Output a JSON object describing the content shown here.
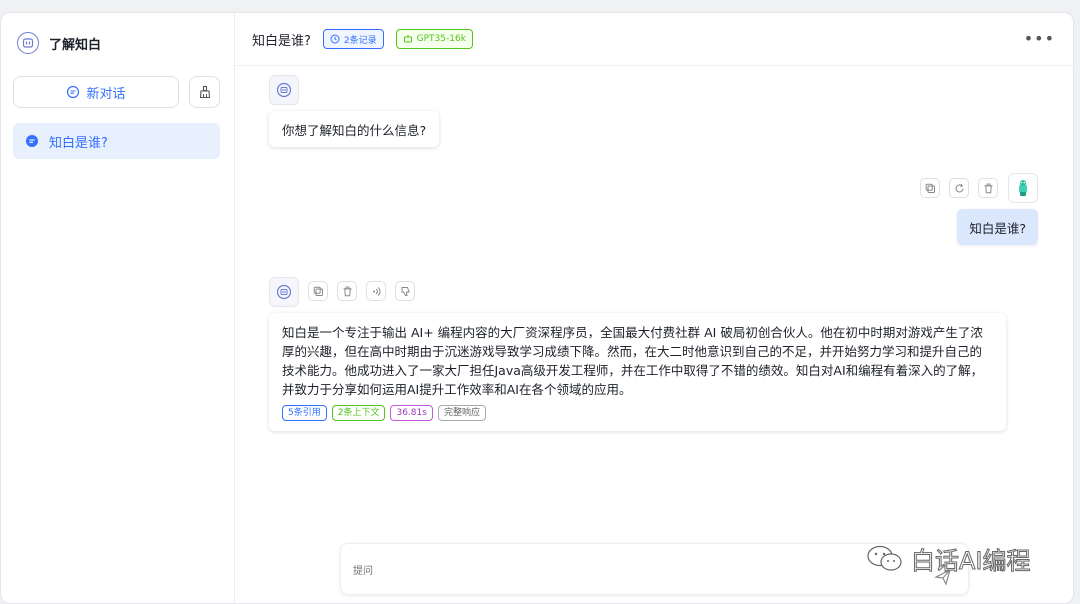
{
  "sidebar": {
    "app_title": "了解知白",
    "new_chat_label": "新对话",
    "history": [
      {
        "label": "知白是谁?"
      }
    ]
  },
  "topbar": {
    "title": "知白是谁?",
    "records_tag": "2条记录",
    "model_tag": "GPT35-16k"
  },
  "messages": {
    "greeting": "你想了解知白的什么信息?",
    "user_question": "知白是谁?",
    "answer": "知白是一个专注于输出 AI+ 编程内容的大厂资深程序员，全国最大付费社群 AI 破局初创合伙人。他在初中时期对游戏产生了浓厚的兴趣，但在高中时期由于沉迷游戏导致学习成绩下降。然而，在大二时他意识到自己的不足，并开始努力学习和提升自己的技术能力。他成功进入了一家大厂担任Java高级开发工程师，并在工作中取得了不错的绩效。知白对AI和编程有着深入的了解，并致力于分享如何运用AI提升工作效率和AI在各个领域的应用。",
    "badges": {
      "quotes": "5条引用",
      "context": "2条上下文",
      "time": "36.81s",
      "full_response": "完整响应"
    }
  },
  "input": {
    "placeholder": "提问"
  },
  "watermark": {
    "text": "白话AI编程"
  },
  "colors": {
    "accent": "#3370ff",
    "green": "#52c41a",
    "purple": "#a03bb8",
    "user_bubble": "#dbe7fd"
  }
}
